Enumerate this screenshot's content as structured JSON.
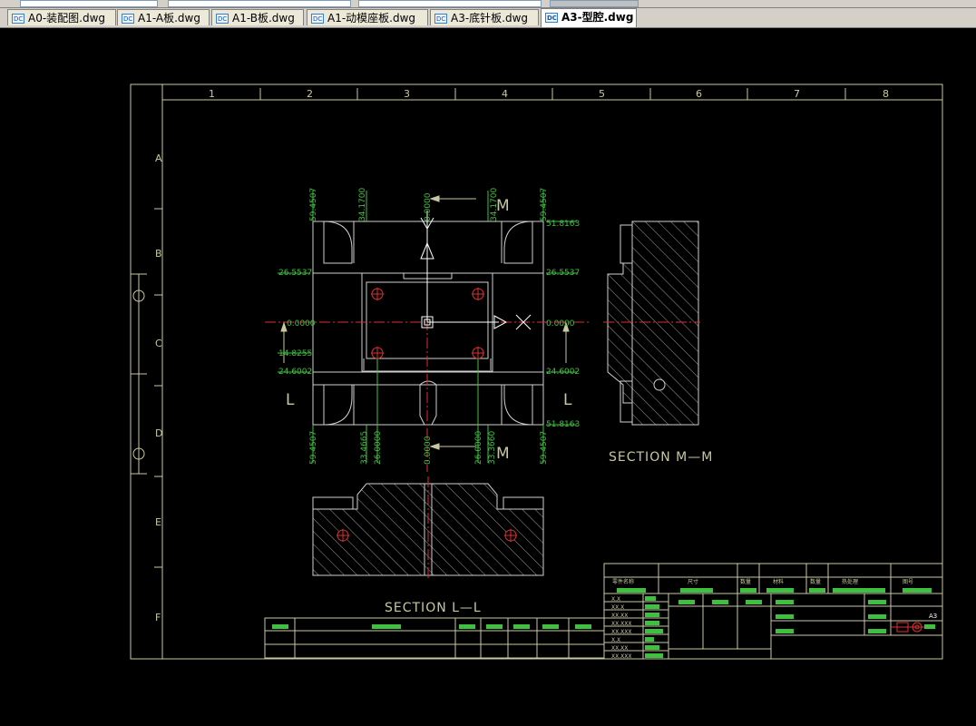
{
  "tabs": [
    {
      "label": "A0-装配图.dwg",
      "active": false
    },
    {
      "label": "A1-A板.dwg",
      "active": false
    },
    {
      "label": "A1-B板.dwg",
      "active": false
    },
    {
      "label": "A1-动模座板.dwg",
      "active": false
    },
    {
      "label": "A3-底针板.dwg",
      "active": false
    },
    {
      "label": "A3-型腔.dwg",
      "active": true
    }
  ],
  "colors": {
    "background": "#000000",
    "frame": "#c8c8a0",
    "drawing": "#d0d0d0",
    "dimension": "#40c040",
    "centerline": "#e03030",
    "text": "#c8c8a0"
  },
  "frame": {
    "col_numbers": [
      "1",
      "2",
      "3",
      "4",
      "5",
      "6",
      "7",
      "8"
    ],
    "row_letters": [
      "A",
      "B",
      "C",
      "D",
      "E",
      "F"
    ],
    "sheet_size": "A3"
  },
  "drawing": {
    "section_mm": "SECTION M—M",
    "section_ll": "SECTION L—L",
    "label_m": "M",
    "label_l": "L",
    "dims_top": [
      "59.4507",
      "34.1700",
      "0.0000",
      "34.1700",
      "59.4507"
    ],
    "dims_bottom": [
      "59.4507",
      "33.4665",
      "26.0000",
      "0.0000",
      "26.0000",
      "33.3660",
      "59.4507"
    ],
    "dims_left": [
      "26.5537",
      "0.0000",
      "14.8255",
      "24.6002"
    ],
    "dims_right": [
      "51.8163",
      "26.5537",
      "0.0000",
      "24.6002",
      "51.8163"
    ]
  },
  "title_block": {
    "cells": [
      "零件名称",
      "尺寸",
      "数量",
      "材料",
      "数量",
      "热处理",
      "图号"
    ],
    "tol_rows": [
      "X.X",
      "XX.X",
      "XX.XX",
      "XX.XXX",
      "XX.XXX",
      "X.X",
      "XX.XX",
      "XX.XXX"
    ]
  }
}
